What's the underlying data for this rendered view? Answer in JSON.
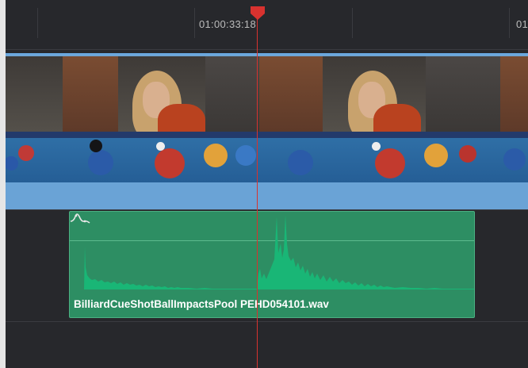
{
  "ruler": {
    "timecode_main": "01:00:33:18",
    "timecode_next": "01"
  },
  "audio_clip": {
    "name": "BilliardCueShotBallImpactsPool PEHD054101.wav"
  },
  "colors": {
    "video_track": "#6aa3d6",
    "audio_clip": "#2d8e63",
    "playhead": "#d8322f"
  },
  "icons": {
    "playhead": "playhead-marker-icon",
    "curve": "volume-curve-icon"
  }
}
